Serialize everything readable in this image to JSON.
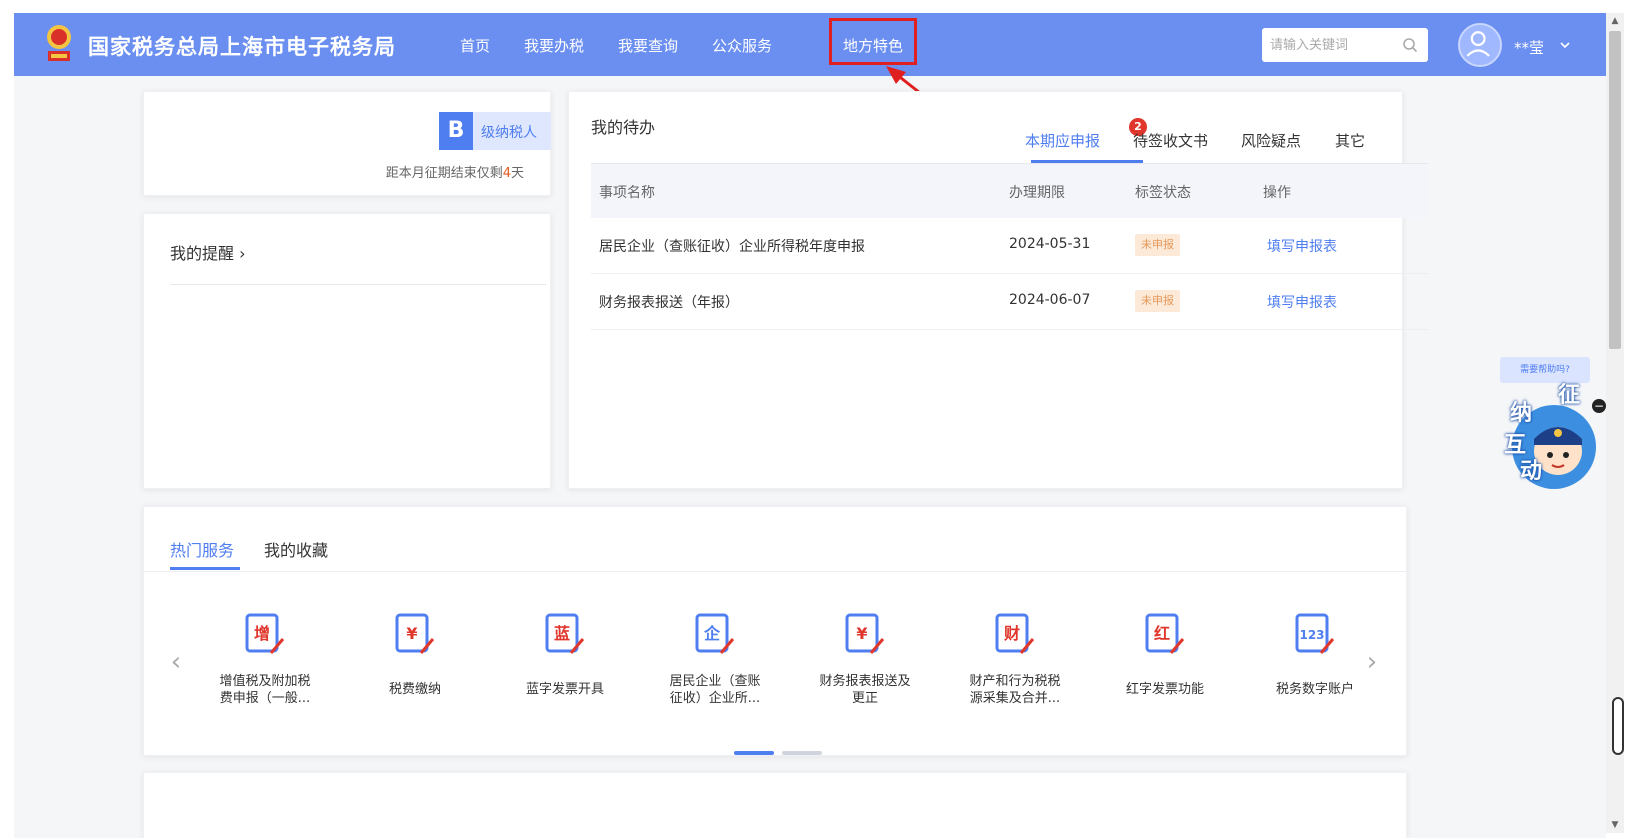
{
  "header": {
    "site_title": "国家税务总局上海市电子税务局",
    "nav": [
      "首页",
      "我要办税",
      "我要查询",
      "公众服务",
      "地方特色"
    ],
    "search_placeholder": "请输入关键词",
    "username": "**莹",
    "brand_color": "#6b8ff0",
    "highlight_color": "#e02020"
  },
  "taxpayer": {
    "level_letter": "B",
    "level_label": "级纳税人",
    "deadline_prefix": "距本月征期结束仅剩",
    "deadline_days": "4",
    "deadline_suffix": "天"
  },
  "reminder": {
    "title": "我的提醒 ›"
  },
  "todo": {
    "title": "我的待办",
    "tabs": [
      {
        "label": "本期应申报",
        "active": true,
        "badge": "2"
      },
      {
        "label": "待签收文书",
        "active": false
      },
      {
        "label": "风险疑点",
        "active": false
      },
      {
        "label": "其它",
        "active": false
      }
    ],
    "columns": [
      "事项名称",
      "办理期限",
      "标签状态",
      "操作"
    ],
    "rows": [
      {
        "name": "居民企业（查账征收）企业所得税年度申报",
        "deadline": "2024-05-31",
        "status": "未申报",
        "action": "填写申报表"
      },
      {
        "name": "财务报表报送（年报）",
        "deadline": "2024-06-07",
        "status": "未申报",
        "action": "填写申报表"
      }
    ]
  },
  "services": {
    "tabs": [
      {
        "label": "热门服务",
        "active": true
      },
      {
        "label": "我的收藏",
        "active": false
      }
    ],
    "prev_icon": "‹",
    "next_icon": "›",
    "items": [
      {
        "icon": "vat-declaration-icon",
        "glyph": "增",
        "line1": "增值税及附加税",
        "line2": "费申报（一般..."
      },
      {
        "icon": "tax-payment-icon",
        "glyph": "¥",
        "line1": "税费缴纳",
        "line2": ""
      },
      {
        "icon": "blue-invoice-icon",
        "glyph": "蓝",
        "line1": "蓝字发票开具",
        "line2": ""
      },
      {
        "icon": "enterprise-income-icon",
        "glyph": "企",
        "line1": "居民企业（查账",
        "line2": "征收）企业所..."
      },
      {
        "icon": "financial-report-icon",
        "glyph": "¥",
        "line1": "财务报表报送及",
        "line2": "更正"
      },
      {
        "icon": "property-tax-icon",
        "glyph": "财",
        "line1": "财产和行为税税",
        "line2": "源采集及合并..."
      },
      {
        "icon": "red-invoice-icon",
        "glyph": "红",
        "line1": "红字发票功能",
        "line2": ""
      },
      {
        "icon": "digital-account-icon",
        "glyph": "123",
        "line1": "税务数字账户",
        "line2": ""
      }
    ],
    "pagination_active": 0,
    "pagination_count": 2
  },
  "assistant": {
    "bubble": "需要帮助吗?",
    "chars": [
      "征",
      "纳",
      "互",
      "动"
    ]
  },
  "colors": {
    "accent": "#4f7ef0",
    "warning_text": "#e55a1c",
    "status_pill_bg": "#fde9d8",
    "badge_red": "#e0362b"
  }
}
